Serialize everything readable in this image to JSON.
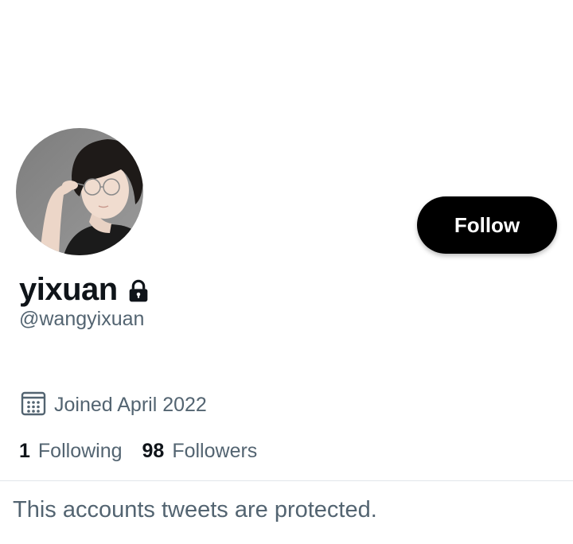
{
  "profile": {
    "display_name": "yixuan",
    "handle": "@wangyixuan",
    "joined": "Joined April 2022",
    "locked": true,
    "avatar_description_icon": "profile-avatar"
  },
  "actions": {
    "follow_label": "Follow"
  },
  "stats": {
    "following_count": "1",
    "following_label": "Following",
    "followers_count": "98",
    "followers_label": "Followers"
  },
  "notice": {
    "protected_text": "This accounts tweets are protected."
  },
  "colors": {
    "text_primary": "#0f1419",
    "text_secondary": "#536471",
    "button_bg": "#000000",
    "button_text": "#ffffff",
    "divider": "#e1e6ea"
  },
  "icons": {
    "lock": "lock-icon",
    "calendar": "calendar-icon"
  }
}
